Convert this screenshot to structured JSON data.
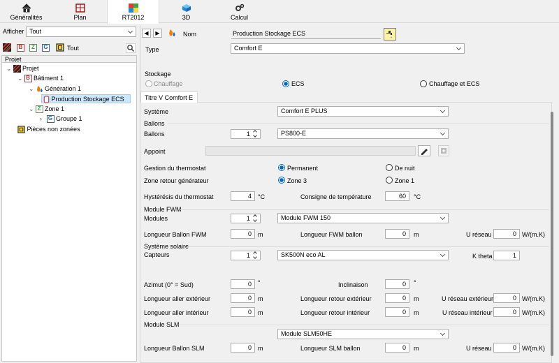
{
  "tabs": [
    {
      "label": "Généralités",
      "icon": "home-icon"
    },
    {
      "label": "Plan",
      "icon": "plan-icon"
    },
    {
      "label": "RT2012",
      "icon": "rt2012-icon"
    },
    {
      "label": "3D",
      "icon": "cube-icon"
    },
    {
      "label": "Calcul",
      "icon": "gears-icon"
    }
  ],
  "left": {
    "afficher_label": "Afficher",
    "afficher_value": "Tout",
    "filter_tout": "Tout",
    "tree_header": "Projet",
    "tree": [
      "Projet",
      "Bâtiment 1",
      "Génération 1",
      "Production Stockage ECS",
      "Zone 1",
      "Groupe 1",
      "Pièces non zonées"
    ],
    "filter_letters": {
      "b": "B",
      "z": "Z",
      "g": "G"
    }
  },
  "header": {
    "nom_label": "Nom",
    "nom_value": "Production Stockage ECS",
    "type_label": "Type",
    "type_value": "Comfort E"
  },
  "stockage": {
    "label": "Stockage",
    "chauffage": "Chauffage",
    "ecs": "ECS",
    "both": "Chauffage et ECS"
  },
  "subtab": "Titre V Comfort E",
  "systeme": {
    "label": "Système",
    "value": "Comfort E PLUS"
  },
  "ballons": {
    "section": "Ballons",
    "label": "Ballons",
    "count": "1",
    "model": "PS800-E",
    "appoint": "Appoint",
    "thermostat_label": "Gestion du thermostat",
    "permanent": "Permanent",
    "de_nuit": "De nuit",
    "zone_retour_label": "Zone retour générateur",
    "zone3": "Zone 3",
    "zone1": "Zone 1",
    "hysteresis_label": "Hystérésis du thermostat",
    "hysteresis": "4",
    "hysteresis_unit": "°C",
    "consigne_label": "Consigne de température",
    "consigne": "60",
    "consigne_unit": "°C"
  },
  "fwm": {
    "section": "Module FWM",
    "modules_label": "Modules",
    "count": "1",
    "model": "Module FWM 150",
    "long_ballon_label": "Longueur Ballon FWM",
    "long_ballon": "0",
    "unit_m": "m",
    "long_fwm_label": "Longueur FWM ballon",
    "long_fwm": "0",
    "u_label": "U réseau",
    "u": "0",
    "u_unit": "W/(m.K)"
  },
  "solaire": {
    "section": "Système solaire",
    "capteurs_label": "Capteurs",
    "count": "1",
    "model": "SK500N eco AL",
    "ktheta_label": "K theta",
    "ktheta": "1",
    "azimut_label": "Azimut (0° = Sud)",
    "azimut": "0",
    "deg": "°",
    "incl_label": "Inclinaison",
    "incl": "0",
    "aller_ext_label": "Longueur aller extérieur",
    "aller_ext": "0",
    "retour_ext_label": "Longueur retour extérieur",
    "retour_ext": "0",
    "u_ext_label": "U réseau extérieur",
    "u_ext": "0",
    "aller_int_label": "Longueur aller intérieur",
    "aller_int": "0",
    "retour_int_label": "Longueur retour intérieur",
    "retour_int": "0",
    "u_int_label": "U réseau intérieur",
    "u_int": "0",
    "unit_m": "m",
    "u_unit": "W/(m.K)"
  },
  "slm": {
    "section": "Module SLM",
    "model": "Module SLM50HE",
    "long_ballon_label": "Longueur Ballon SLM",
    "long_ballon": "0",
    "long_slm_label": "Longueur SLM ballon",
    "long_slm": "0",
    "u_label": "U réseau",
    "u": "0",
    "unit_m": "m",
    "u_unit": "W/(m.K)"
  }
}
